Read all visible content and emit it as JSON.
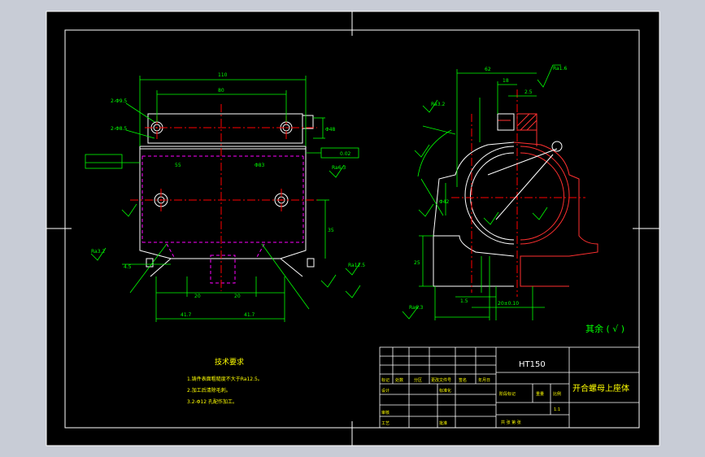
{
  "drawing": {
    "material": "HT150",
    "part_name": "开合螺母上座体",
    "tech_requirements_title": "技术要求",
    "tech_requirements": [
      "1.铸件表面粗糙度不大于Ra12.5。",
      "2.加工后清除毛刺。",
      "3.2-Φ12 孔配作加工。"
    ],
    "colors": {
      "paper": "#000000",
      "border": "#ffffff",
      "dimension": "#00ff00",
      "centerline": "#ff0000",
      "hidden": "#ff00ff",
      "outline": "#ffffff",
      "section": "#ff3030",
      "annotation": "#ffff00"
    },
    "dims_front": {
      "overall_width": "110",
      "bolt_spacing": "80",
      "hole_top": "2-Φ9.5",
      "hole_side": "2-Φ8.5",
      "center_span": "Φ83",
      "left_offset": "55",
      "bottom_left": "20",
      "bottom_right": "20",
      "bottom_total_left": "41.7",
      "bottom_total_right": "41.7",
      "right_height": "35",
      "flange": "Φ48",
      "side_small": "4.5",
      "tolerance_frame": "0.02"
    },
    "dims_side": {
      "top_width": "62",
      "top_step": "18",
      "hole_depth": "2.5",
      "bore": "Φ42",
      "bottom_depth": "1.5",
      "base": "25",
      "bottom_gap": "20±0.10"
    },
    "roughness": [
      "Ra3.2",
      "Ra6.3",
      "Ra12.5",
      "Ra1.6"
    ],
    "roughness_note": "其余 ( √ )",
    "title_block": {
      "labels": [
        "标记",
        "处数",
        "分区",
        "更改文件号",
        "签名",
        "年月日"
      ],
      "rows": [
        "设计",
        "审核",
        "工艺",
        "标准化",
        "批准"
      ],
      "stage_labels": [
        "阶段标记",
        "重量",
        "比例"
      ],
      "scale": "1:1",
      "sheet": "共 张 第 张"
    }
  }
}
